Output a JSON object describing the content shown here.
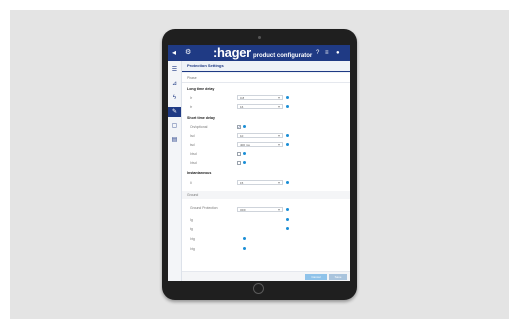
{
  "app": {
    "brand": ":hager",
    "subtitle": "product configurator",
    "back_icon": "arrow-left-icon",
    "settings_icon": "gear-icon"
  },
  "header_icons": [
    "help-icon",
    "menu-icon",
    "user-icon"
  ],
  "sidebar": {
    "items": [
      {
        "name": "list",
        "glyph": "☰"
      },
      {
        "name": "chart",
        "glyph": "⊿"
      },
      {
        "name": "power",
        "glyph": "ϟ"
      },
      {
        "name": "wrench",
        "glyph": "✎"
      },
      {
        "name": "document",
        "glyph": "▢"
      },
      {
        "name": "printer",
        "glyph": "▤"
      }
    ],
    "active_index": 3
  },
  "main": {
    "tab_title": "Protection Settings",
    "sections": {
      "phase": "Phase",
      "long_time": "Long time delay",
      "short_time": "Short time delay",
      "instantaneous": "Instantaneous",
      "ground": "Ground"
    },
    "rows": {
      "ir_label": "Ir",
      "ir_value": "0.8",
      "tr_label": "tr",
      "tr_value": "16",
      "sd_on_label": "On/optional",
      "isd_label": "Isd",
      "isd_value": "10",
      "tsd_label": "tsd",
      "tsd_value": "400 ms",
      "i2t_label": "I²tsd",
      "i2t_label2": "I²tsd",
      "ii_label": "Ii",
      "ii_value": "15",
      "gp_label": "Ground Protection",
      "gp_value": "OFF",
      "ig_label": "Ig",
      "tg_label": "tg",
      "i2tg_label": "I²tg",
      "i2tg_label2": "I²tg"
    },
    "footer": {
      "cancel": "Cancel",
      "save": "Save"
    }
  },
  "colors": {
    "primary": "#1f3a84",
    "accent": "#1b8ed6",
    "background": "#e4e4e4"
  }
}
